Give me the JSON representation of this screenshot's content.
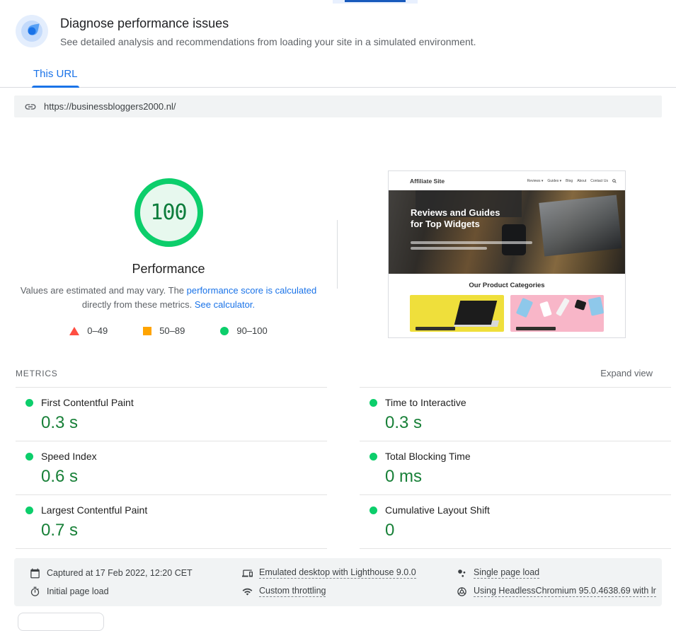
{
  "header": {
    "title": "Diagnose performance issues",
    "subtitle": "See detailed analysis and recommendations from loading your site in a simulated environment."
  },
  "tabs": {
    "this_url": "This URL"
  },
  "url_bar": {
    "url": "https://businessbloggers2000.nl/"
  },
  "score": {
    "value": "100",
    "label": "Performance",
    "desc_1": "Values are estimated and may vary. The ",
    "link_1": "performance score is calculated",
    "desc_2": " directly from these metrics. ",
    "link_2": "See calculator.",
    "legend": [
      {
        "shape": "triangle",
        "color": "#ff4e42",
        "range": "0–49"
      },
      {
        "shape": "square",
        "color": "#ffa400",
        "range": "50–89"
      },
      {
        "shape": "circle",
        "color": "#0cce6b",
        "range": "90–100"
      }
    ]
  },
  "thumbnail": {
    "site_name": "Affiliate Site",
    "nav": [
      "Reviews ▾",
      "Guides ▾",
      "Blog",
      "About",
      "Contact Us"
    ],
    "hero_title_line1": "Reviews and Guides",
    "hero_title_line2": "for Top Widgets",
    "section_title": "Our Product Categories"
  },
  "metrics": {
    "section_label": "METRICS",
    "expand_label": "Expand view",
    "items": [
      {
        "name": "First Contentful Paint",
        "value": "0.3 s",
        "status_color": "#0cce6b"
      },
      {
        "name": "Time to Interactive",
        "value": "0.3 s",
        "status_color": "#0cce6b"
      },
      {
        "name": "Speed Index",
        "value": "0.6 s",
        "status_color": "#0cce6b"
      },
      {
        "name": "Total Blocking Time",
        "value": "0 ms",
        "status_color": "#0cce6b"
      },
      {
        "name": "Largest Contentful Paint",
        "value": "0.7 s",
        "status_color": "#0cce6b"
      },
      {
        "name": "Cumulative Layout Shift",
        "value": "0",
        "status_color": "#0cce6b"
      }
    ]
  },
  "footer": {
    "items": [
      {
        "icon": "calendar-icon",
        "text": "Captured at 17 Feb 2022, 12:20 CET"
      },
      {
        "icon": "stopwatch-icon",
        "text": "Initial page load"
      },
      {
        "icon": "devices-icon",
        "text": "Emulated desktop with Lighthouse 9.0.0"
      },
      {
        "icon": "network-icon",
        "text": "Custom throttling"
      },
      {
        "icon": "page-load-icon",
        "text": "Single page load"
      },
      {
        "icon": "chrome-icon",
        "text": "Using HeadlessChromium 95.0.4638.69 with lr"
      }
    ]
  },
  "colors": {
    "link_blue": "#1a73e8",
    "tab_indicator_blue": "#185abc",
    "pass_green": "#0cce6b",
    "value_green": "#188038",
    "fail_red": "#ff4e42",
    "average_orange": "#ffa400",
    "gray_text": "#5f6368",
    "surface_gray": "#f1f3f4"
  }
}
